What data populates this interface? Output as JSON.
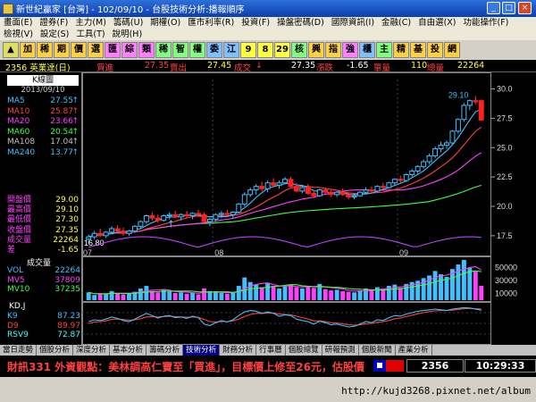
{
  "window": {
    "title": "新世紀贏家 [台灣] - 102/09/10 - 台股技術分析:播報順序",
    "buttons": [
      "_",
      "□",
      "×"
    ]
  },
  "menu": {
    "row1": [
      "畫面(E)",
      "證券(F)",
      "主力(M)",
      "籌碼(U)",
      "期權(O)",
      "匯市利率(R)",
      "投資(F)",
      "操盤密碼(D)",
      "國際資訊(I)",
      "金融(C)",
      "自由選(X)",
      "功能操作(F)"
    ],
    "row2": [
      "檢視(V)",
      "設定(S)",
      "工具(T)",
      "說明(H)"
    ]
  },
  "toolbar": [
    "▲",
    "加",
    "稀",
    "期",
    "價",
    "選",
    "匯",
    "綜",
    "類",
    "稀",
    "智",
    "權",
    "委",
    "江",
    "9",
    "8",
    "29",
    "核",
    "興",
    "指",
    "強",
    "櫃",
    "主",
    "精",
    "基",
    "投",
    "網"
  ],
  "quote": {
    "symbol": "2356 英業達(日)",
    "bid_label": "買進",
    "bid": "27.35",
    "ask_label": "賣出",
    "ask": "27.45",
    "last_label": "成交",
    "last": "27.35",
    "chg_label": "漲跌",
    "chg": "-1.65",
    "lot_label": "單量",
    "lot": "110",
    "vol_label": "總量",
    "vol": "22264"
  },
  "left_panel": {
    "header": "K線圖",
    "date": "2013/09/10",
    "ma": [
      {
        "label": "MA5",
        "value": "27.55",
        "arrow": "↑",
        "color": "#40c0ff"
      },
      {
        "label": "MA10",
        "value": "25.87",
        "arrow": "↑",
        "color": "#ff4040"
      },
      {
        "label": "MA20",
        "value": "23.66",
        "arrow": "↑",
        "color": "#ff40ff"
      },
      {
        "label": "MA60",
        "value": "20.54",
        "arrow": "↑",
        "color": "#40ff40"
      },
      {
        "label": "MA108",
        "value": "17.04",
        "arrow": "↑",
        "color": "#c0c0c0"
      },
      {
        "label": "MA240",
        "value": "13.77",
        "arrow": "↑",
        "color": "#40c0ff"
      }
    ],
    "ohlc": [
      {
        "label": "開盤價",
        "value": "29.00"
      },
      {
        "label": "最高價",
        "value": "29.10"
      },
      {
        "label": "最低價",
        "value": "27.30"
      },
      {
        "label": "收盤價",
        "value": "27.35"
      },
      {
        "label": "成交量",
        "value": "22264"
      },
      {
        "label": "差",
        "value": "-1.65"
      }
    ]
  },
  "chart_labels": {
    "low_marker": "16.80",
    "high_marker": "29.10",
    "month_labels": [
      "07",
      "08",
      "09"
    ],
    "price_ticks": [
      "30.0",
      "27.5",
      "25.0",
      "22.5",
      "20.0",
      "17.5"
    ],
    "vol_ticks": [
      "50000",
      "30000",
      "10000"
    ]
  },
  "volume_panel": {
    "title": "成交量",
    "rows": [
      {
        "label": "VOL",
        "value": "22264",
        "color": "#40c0ff"
      },
      {
        "label": "MV5",
        "value": "37809",
        "color": "#ff40ff"
      },
      {
        "label": "MV10",
        "value": "37235",
        "color": "#40ff40"
      }
    ]
  },
  "kd_panel": {
    "title": "KD,J",
    "rows": [
      {
        "label": "K9",
        "value": "87.23",
        "color": "#40c0ff"
      },
      {
        "label": "D9",
        "value": "89.97",
        "color": "#ff4040"
      },
      {
        "label": "RSV9",
        "value": "72.87",
        "color": "#40ffff"
      }
    ]
  },
  "tabs": [
    "當日走勢",
    "個股分析",
    "深度分析",
    "基本分析",
    "籌碼分析",
    "技術分析",
    "財務分析",
    "行事曆",
    "個股總覽",
    "研報預測",
    "個股新聞",
    "產業分析"
  ],
  "active_tab": "技術分析",
  "news": "財訊331 外資觀點：美林調高仁寶至「買進」，目標價上修至26元，估股價",
  "status": {
    "code": "2356",
    "clock": "10:29:33"
  },
  "watermark": "http://kujd3268.pixnet.net/album",
  "chart_data": {
    "type": "candlestick",
    "price_range": [
      16.5,
      30.8
    ],
    "candles": [
      [
        17.2,
        17.6,
        16.8,
        17.4
      ],
      [
        17.4,
        17.9,
        17.2,
        17.7
      ],
      [
        17.7,
        18.1,
        17.4,
        17.5
      ],
      [
        17.5,
        17.9,
        17.3,
        17.8
      ],
      [
        17.8,
        18.3,
        17.6,
        18.1
      ],
      [
        18.1,
        18.4,
        17.8,
        17.9
      ],
      [
        17.9,
        18.2,
        17.5,
        17.7
      ],
      [
        17.7,
        18.0,
        17.5,
        17.9
      ],
      [
        17.9,
        18.4,
        17.8,
        18.3
      ],
      [
        18.3,
        18.8,
        18.1,
        18.7
      ],
      [
        18.7,
        19.3,
        18.5,
        19.2
      ],
      [
        19.2,
        19.5,
        18.8,
        19.0
      ],
      [
        19.0,
        19.3,
        18.6,
        18.8
      ],
      [
        18.8,
        19.3,
        18.7,
        19.2
      ],
      [
        19.2,
        19.5,
        18.9,
        19.3
      ],
      [
        19.3,
        19.6,
        19.0,
        19.1
      ],
      [
        19.1,
        19.4,
        18.8,
        19.3
      ],
      [
        19.3,
        19.6,
        19.0,
        19.2
      ],
      [
        19.2,
        19.5,
        18.9,
        19.4
      ],
      [
        19.4,
        19.7,
        19.1,
        19.3
      ],
      [
        19.3,
        19.5,
        18.5,
        18.7
      ],
      [
        18.7,
        19.0,
        18.3,
        18.9
      ],
      [
        18.9,
        19.4,
        18.7,
        19.3
      ],
      [
        19.3,
        19.6,
        19.0,
        19.4
      ],
      [
        19.4,
        19.7,
        19.1,
        19.3
      ],
      [
        19.3,
        19.6,
        19.0,
        19.5
      ],
      [
        19.5,
        20.3,
        19.4,
        20.2
      ],
      [
        20.2,
        21.2,
        20.0,
        21.0
      ],
      [
        21.0,
        21.6,
        20.8,
        21.4
      ],
      [
        21.4,
        21.9,
        21.0,
        21.7
      ],
      [
        21.7,
        22.1,
        21.3,
        21.5
      ],
      [
        21.5,
        22.2,
        21.2,
        22.0
      ],
      [
        22.0,
        22.4,
        21.6,
        21.8
      ],
      [
        21.8,
        22.2,
        21.5,
        22.0
      ],
      [
        22.0,
        22.5,
        21.9,
        22.3
      ],
      [
        22.3,
        22.5,
        21.6,
        21.7
      ],
      [
        21.7,
        22.0,
        21.2,
        21.3
      ],
      [
        21.3,
        21.8,
        21.1,
        21.6
      ],
      [
        21.6,
        21.9,
        21.0,
        21.1
      ],
      [
        21.1,
        21.4,
        20.7,
        20.9
      ],
      [
        20.9,
        21.5,
        20.8,
        21.4
      ],
      [
        21.4,
        21.6,
        21.1,
        21.2
      ],
      [
        21.2,
        21.4,
        20.8,
        21.0
      ],
      [
        21.0,
        21.3,
        20.8,
        21.2
      ],
      [
        21.2,
        21.5,
        20.9,
        21.0
      ],
      [
        21.0,
        21.2,
        20.6,
        20.8
      ],
      [
        20.8,
        21.1,
        20.6,
        20.9
      ],
      [
        20.9,
        21.3,
        20.8,
        21.2
      ],
      [
        21.2,
        21.6,
        21.0,
        21.4
      ],
      [
        21.4,
        21.7,
        21.1,
        21.3
      ],
      [
        21.3,
        21.8,
        21.2,
        21.7
      ],
      [
        21.7,
        22.0,
        21.4,
        21.6
      ],
      [
        21.6,
        22.1,
        21.5,
        22.0
      ],
      [
        22.0,
        22.4,
        21.8,
        22.3
      ],
      [
        22.3,
        22.6,
        22.0,
        22.2
      ],
      [
        22.2,
        22.8,
        22.1,
        22.7
      ],
      [
        22.7,
        23.2,
        22.5,
        23.0
      ],
      [
        23.0,
        23.5,
        22.8,
        23.4
      ],
      [
        23.4,
        24.0,
        23.2,
        23.8
      ],
      [
        23.8,
        24.5,
        23.6,
        24.3
      ],
      [
        24.3,
        25.1,
        24.1,
        24.9
      ],
      [
        24.9,
        25.5,
        24.6,
        25.2
      ],
      [
        25.2,
        25.6,
        24.9,
        25.4
      ],
      [
        25.4,
        26.5,
        25.3,
        26.4
      ],
      [
        26.4,
        27.5,
        26.2,
        27.4
      ],
      [
        27.4,
        28.8,
        27.2,
        28.6
      ],
      [
        28.6,
        29.1,
        28.2,
        29.0
      ],
      [
        29.0,
        29.4,
        28.7,
        28.9
      ],
      [
        29.0,
        29.1,
        27.3,
        27.35
      ]
    ],
    "volume": [
      12,
      8,
      10,
      9,
      14,
      11,
      9,
      10,
      13,
      18,
      22,
      14,
      12,
      16,
      13,
      11,
      12,
      10,
      11,
      9,
      18,
      14,
      13,
      11,
      10,
      12,
      22,
      35,
      28,
      24,
      20,
      26,
      22,
      18,
      21,
      24,
      20,
      18,
      22,
      19,
      25,
      17,
      15,
      16,
      14,
      13,
      12,
      15,
      18,
      16,
      20,
      17,
      22,
      24,
      19,
      25,
      28,
      30,
      34,
      38,
      45,
      40,
      36,
      48,
      55,
      62,
      50,
      44,
      22
    ],
    "vol_range": [
      0,
      62000
    ],
    "kd": {
      "k": [
        55,
        60,
        58,
        62,
        68,
        64,
        58,
        55,
        62,
        70,
        78,
        72,
        65,
        70,
        72,
        66,
        68,
        64,
        70,
        66,
        48,
        44,
        52,
        58,
        54,
        60,
        72,
        82,
        86,
        84,
        78,
        82,
        78,
        70,
        74,
        72,
        62,
        58,
        55,
        48,
        56,
        52,
        46,
        48,
        44,
        40,
        42,
        48,
        55,
        52,
        60,
        58,
        66,
        72,
        70,
        76,
        80,
        84,
        86,
        88,
        90,
        88,
        86,
        90,
        92,
        94,
        93,
        90,
        87
      ],
      "d": [
        50,
        54,
        55,
        57,
        61,
        62,
        61,
        59,
        60,
        63,
        68,
        69,
        68,
        69,
        70,
        69,
        68,
        67,
        68,
        67,
        61,
        55,
        54,
        55,
        55,
        57,
        62,
        69,
        75,
        78,
        78,
        79,
        79,
        76,
        75,
        74,
        70,
        66,
        62,
        57,
        57,
        55,
        52,
        51,
        49,
        46,
        45,
        46,
        49,
        50,
        53,
        55,
        58,
        63,
        65,
        69,
        73,
        77,
        80,
        83,
        85,
        86,
        86,
        87,
        89,
        91,
        92,
        91,
        90
      ],
      "range": [
        0,
        100
      ]
    }
  }
}
